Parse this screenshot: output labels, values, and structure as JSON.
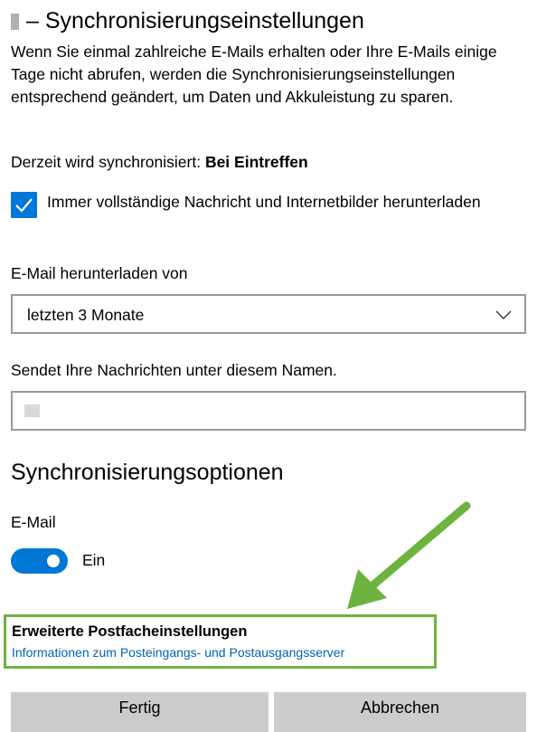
{
  "header": {
    "title": "– Synchronisierungseinstellungen"
  },
  "description": "Wenn Sie einmal zahlreiche E-Mails erhalten oder Ihre E-Mails einige Tage nicht abrufen, werden die Synchronisierungseinstellungen entsprechend geändert, um Daten und Akkuleistung zu sparen.",
  "sync_status": {
    "prefix": "Derzeit wird synchronisiert:",
    "value": "Bei Eintreffen"
  },
  "full_download": {
    "checked": true,
    "label": "Immer vollständige Nachricht und Internetbilder herunterladen"
  },
  "download_from": {
    "label": "E-Mail herunterladen von",
    "selected": "letzten 3 Monate",
    "chevron_icon": "chevron-down-icon"
  },
  "sender_name": {
    "label": "Sendet Ihre Nachrichten unter diesem Namen.",
    "value": ""
  },
  "sync_options": {
    "heading": "Synchronisierungsoptionen",
    "email_label": "E-Mail",
    "toggle_state": "Ein",
    "toggle_on": true
  },
  "advanced": {
    "title": "Erweiterte Postfacheinstellungen",
    "link": "Informationen zum Posteingangs- und Postausgangsserver"
  },
  "buttons": {
    "done": "Fertig",
    "cancel": "Abbrechen"
  },
  "colors": {
    "accent": "#0078d7",
    "link": "#0063b1",
    "highlight": "#6db33f",
    "button_bg": "#cccccc"
  }
}
